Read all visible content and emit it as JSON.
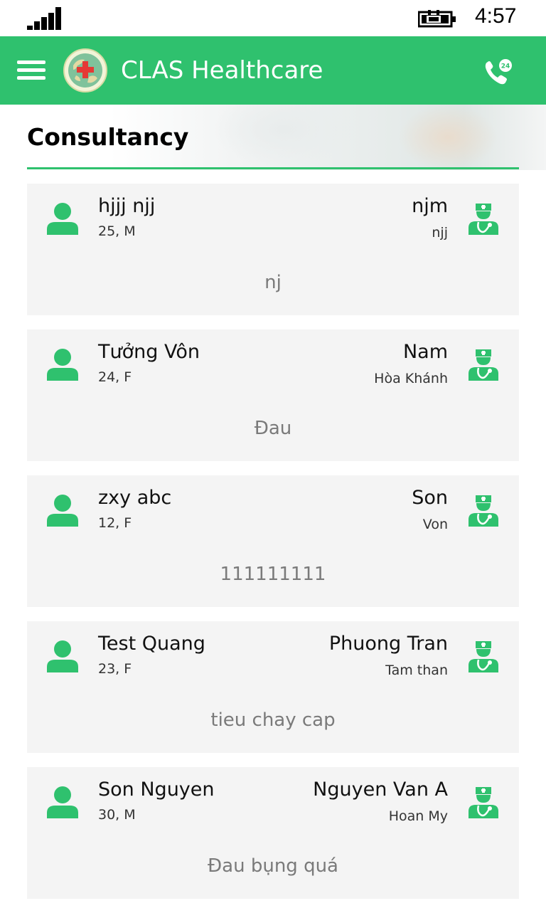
{
  "status_bar": {
    "time": "4:57",
    "signal_icon": "signal-bars-icon",
    "battery_icon": "battery-charging-icon"
  },
  "app_bar": {
    "title": "CLAS Healthcare",
    "menu_icon": "hamburger-menu-icon",
    "logo": "globe-red-cross-logo",
    "call_icon": "phone-24h-icon",
    "background_color": "#2fc16e"
  },
  "page": {
    "title": "Consultancy",
    "accent_color": "#2fc16e"
  },
  "consultations": [
    {
      "patient_name": "hjjj njj",
      "patient_info": "25, M",
      "doctor_name": "njm",
      "doctor_hospital": "njj",
      "symptom": "nj"
    },
    {
      "patient_name": "Tưởng Vôn",
      "patient_info": "24, F",
      "doctor_name": "Nam",
      "doctor_hospital": "Hòa Khánh",
      "symptom": "Đau"
    },
    {
      "patient_name": "zxy abc",
      "patient_info": "12, F",
      "doctor_name": "Son",
      "doctor_hospital": "Von",
      "symptom": "111111111"
    },
    {
      "patient_name": "Test Quang",
      "patient_info": "23, F",
      "doctor_name": "Phuong Tran",
      "doctor_hospital": "Tam than",
      "symptom": "tieu chay cap"
    },
    {
      "patient_name": "Son Nguyen",
      "patient_info": "30, M",
      "doctor_name": "Nguyen Van A",
      "doctor_hospital": "Hoan My",
      "symptom": "Đau bụng quá"
    }
  ]
}
